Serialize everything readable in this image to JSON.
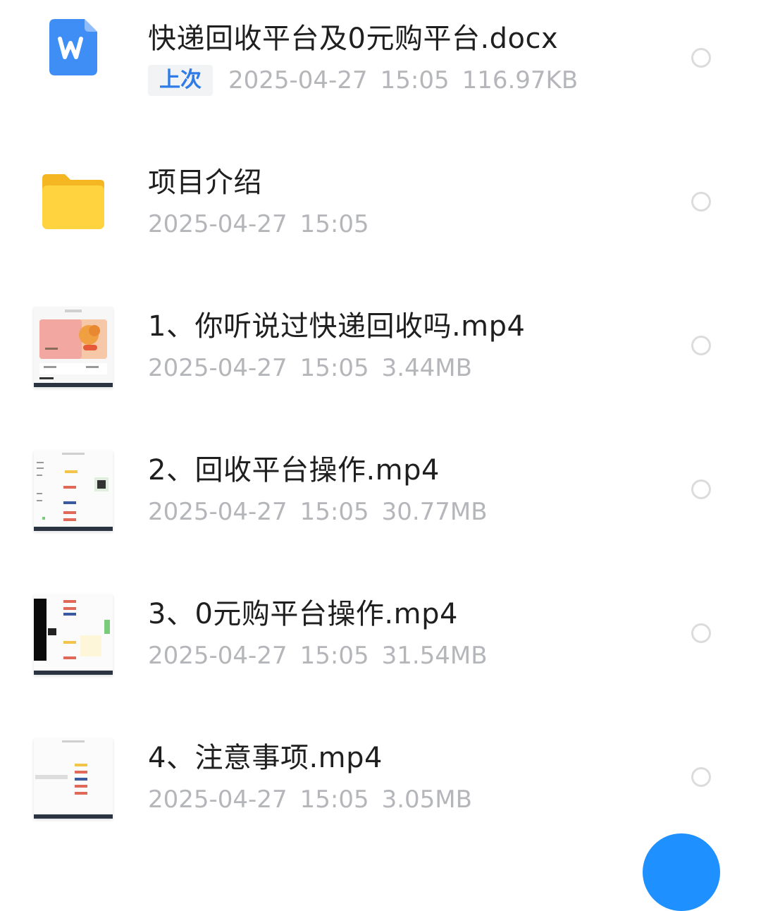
{
  "files": [
    {
      "name": "快递回收平台及0元购平台.docx",
      "badge": "上次",
      "date": "2025-04-27",
      "time": "15:05",
      "size": "116.97KB",
      "icon": "word-doc-icon"
    },
    {
      "name": "项目介绍",
      "date": "2025-04-27",
      "time": "15:05",
      "icon": "folder-icon"
    },
    {
      "name": "1、你听说过快递回收吗.mp4",
      "date": "2025-04-27",
      "time": "15:05",
      "size": "3.44MB",
      "icon": "video-thumbnail"
    },
    {
      "name": "2、回收平台操作.mp4",
      "date": "2025-04-27",
      "time": "15:05",
      "size": "30.77MB",
      "icon": "video-thumbnail"
    },
    {
      "name": "3、0元购平台操作.mp4",
      "date": "2025-04-27",
      "time": "15:05",
      "size": "31.54MB",
      "icon": "video-thumbnail"
    },
    {
      "name": "4、注意事项.mp4",
      "date": "2025-04-27",
      "time": "15:05",
      "size": "3.05MB",
      "icon": "video-thumbnail"
    }
  ],
  "colors": {
    "accent": "#2f7be8",
    "title": "#1f1f1f",
    "meta": "#b4b6ba",
    "folder": "#ffc83a",
    "word": "#3f8ef5"
  }
}
